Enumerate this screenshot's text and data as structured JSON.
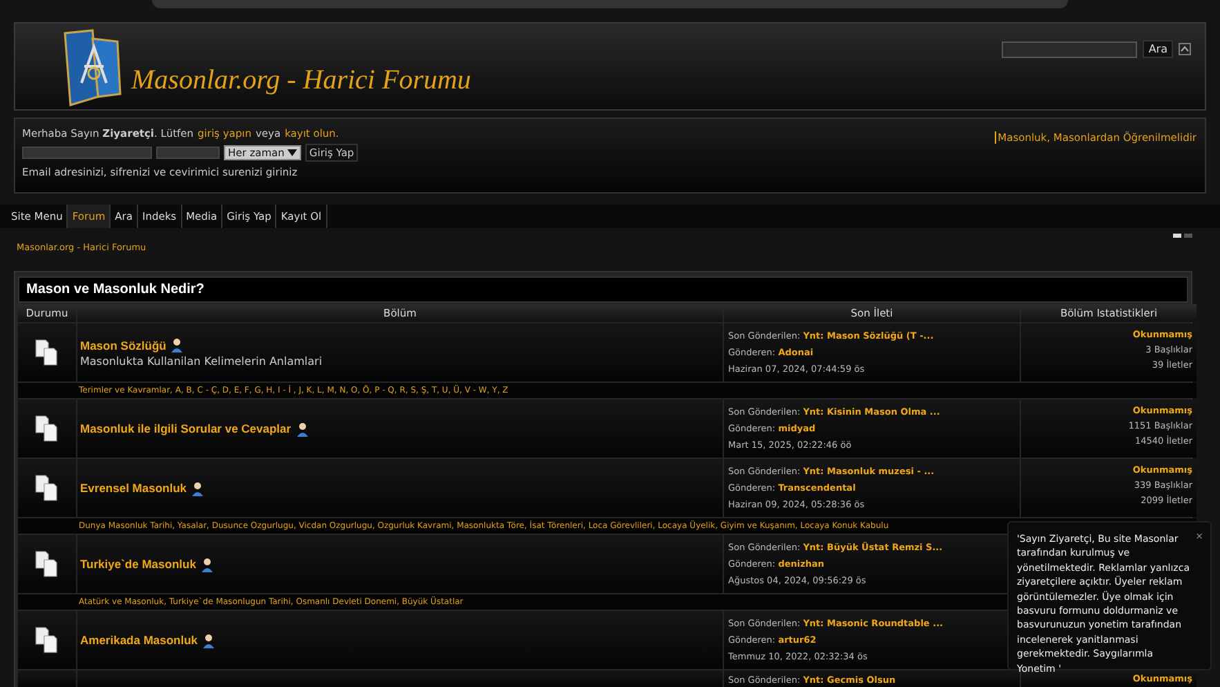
{
  "header": {
    "site_title": "Masonlar.org - Harici Forumu",
    "search_button": "Ara"
  },
  "login": {
    "greeting": "Merhaba Sayın **Ziyaretçi**. Lütfen",
    "login_link": "giriş yapın",
    "or": "veya",
    "register_link": "kayıt olun.",
    "duration": "Her zaman",
    "login_button": "Giriş Yap",
    "hint": "Email adresinizi, sifrenizi ve cevirimici surenizi giriniz",
    "news": "Masonluk, Masonlardan Öğrenilmelidir"
  },
  "nav": [
    {
      "label": "Site Menu",
      "selected": false
    },
    {
      "label": "Forum",
      "selected": true
    },
    {
      "label": "Ara",
      "selected": false
    },
    {
      "label": "Indeks",
      "selected": false
    },
    {
      "label": "Media",
      "selected": false
    },
    {
      "label": "Giriş Yap",
      "selected": false
    },
    {
      "label": "Kayıt Ol",
      "selected": false
    }
  ],
  "breadcrumb": "Masonlar.org - Harici Forumu",
  "category": {
    "title": "Mason ve Masonluk Nedir?",
    "columns": [
      "Durumu",
      "Bölüm",
      "Son İleti",
      "Bölüm Istatistikleri"
    ],
    "rows": [
      {
        "title": "Mason Sözlüğü",
        "description": "Masonlukta Kullanilan Kelimelerin Anlamlari",
        "last_label": "Son Gönderilen:",
        "last_topic": "Ynt: Mason Sözlüğü (T -...",
        "by_label": "Gönderen:",
        "author": "Adonai",
        "date": "Haziran 07, 2024, 07:44:59 ös",
        "status": "Okunmamış",
        "topics": "3 Başlıklar",
        "posts": "39 İletler",
        "subboards": "Terimler ve Kavramlar, A, B, C - Ç, D, E, F, G, H, I - İ , J, K, L, M, N, O, Ö, P - Q, R, S, Ş, T, U, Ü, V - W, Y, Z"
      },
      {
        "title": "Masonluk ile ilgili Sorular ve Cevaplar",
        "last_label": "Son Gönderilen:",
        "last_topic": "Ynt: Kisinin Mason Olma ...",
        "by_label": "Gönderen:",
        "author": "midyad",
        "date": "Mart 15, 2025, 02:22:46 öö",
        "status": "Okunmamış",
        "topics": "1151 Başlıklar",
        "posts": "14540 İletler"
      },
      {
        "title": "Evrensel Masonluk",
        "last_label": "Son Gönderilen:",
        "last_topic": "Ynt: Masonluk muzesi - ...",
        "by_label": "Gönderen:",
        "author": "Transcendental",
        "date": "Haziran 09, 2024, 05:28:36 ös",
        "status": "Okunmamış",
        "topics": "339 Başlıklar",
        "posts": "2099 İletler",
        "subboards": "Dunya Masonluk Tarihi, Yasalar, Dusunce Ozgurlugu, Vicdan Ozgurlugu, Ozgurluk Kavrami, Masonlukta Töre, İsat Törenleri, Loca Görevlileri, Locaya Üyelik, Giyim ve Kuşanım, Locaya Konuk Kabulu"
      },
      {
        "title": "Turkiye`de Masonluk",
        "last_label": "Son Gönderilen:",
        "last_topic": "Ynt: Büyük Üstat Remzi S...",
        "by_label": "Gönderen:",
        "author": "denizhan",
        "date": "Ağustos 04, 2024, 09:56:29 ös",
        "subboards": "Atatürk ve Masonluk, Turkiye`de Masonlugun Tarihi, Osmanlı Devleti Donemi, Büyük Üstatlar"
      },
      {
        "title": "Amerikada Masonluk",
        "last_label": "Son Gönderilen:",
        "last_topic": "Ynt: Masonic Roundtable ...",
        "by_label": "Gönderen:",
        "author": "artur62",
        "date": "Temmuz 10, 2022, 02:32:34 ös"
      },
      {
        "last_label": "Son Gönderilen:",
        "last_topic": "Ynt: Gecmis Olsun",
        "status": "Okunmamış"
      }
    ]
  },
  "popup": {
    "text": "'Sayın Ziyaretçi, Bu site Masonlar tarafından kurulmuş ve yönetilmektedir. Reklamlar yanlızca ziyaretçilere açıktır. Üyeler reklam görüntülemezler. Üye olmak için basvuru formunu doldurmaniz ve basvurunuzun yonetim tarafından incelenerek yanitlanmasi gerekmektedir. Saygılarımla Yonetim '",
    "close": "×"
  }
}
